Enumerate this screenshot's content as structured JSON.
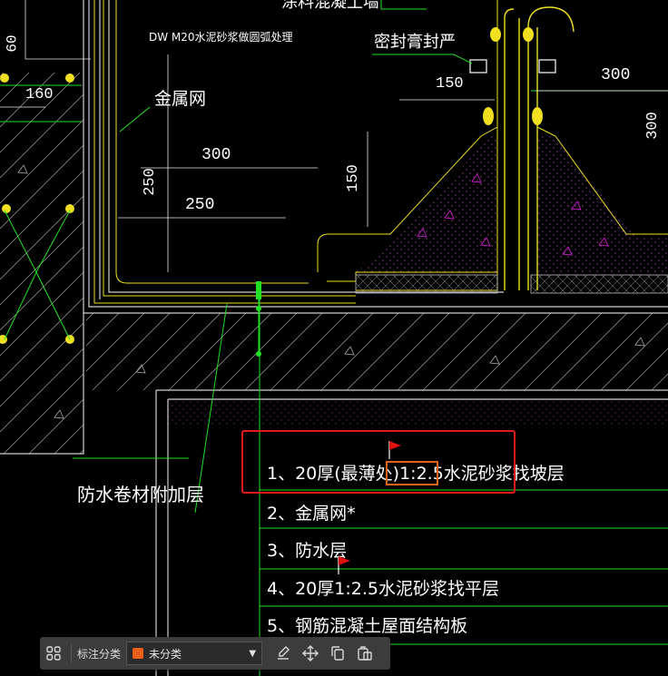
{
  "drawing": {
    "labels": {
      "top_partial": "涂料混凝土墙",
      "dw_note": "DW M20水泥砂浆做圆弧处理",
      "metal_mesh": "金属网",
      "sealant": "密封膏封严",
      "waterproof_add_layer": "防水卷材附加层"
    },
    "dimensions": {
      "d60": "60",
      "d160": "160",
      "d300a": "300",
      "d250h": "250",
      "d250v": "250",
      "d150a": "150",
      "d150v": "150",
      "d300b": "300",
      "d300v": "300"
    },
    "notes": [
      "1、20厚(最薄处)1:2.5水泥砂浆找坡层",
      "2、金属网*",
      "3、防水层",
      "4、20厚1:2.5水泥砂浆找平层",
      "5、钢筋混凝土屋面结构板"
    ]
  },
  "toolbar": {
    "label": "标注分类",
    "category_value": "未分类",
    "category_color": "#e8601c",
    "icons": [
      "grid-icon",
      "edit-icon",
      "move-icon",
      "copy-icon",
      "paste-icon"
    ]
  },
  "colors": {
    "background": "#000000",
    "line_green": "#22e022",
    "line_yellow": "#f0e020",
    "hatch_magenta": "#e020e0",
    "highlight_red": "#e01a1a"
  }
}
